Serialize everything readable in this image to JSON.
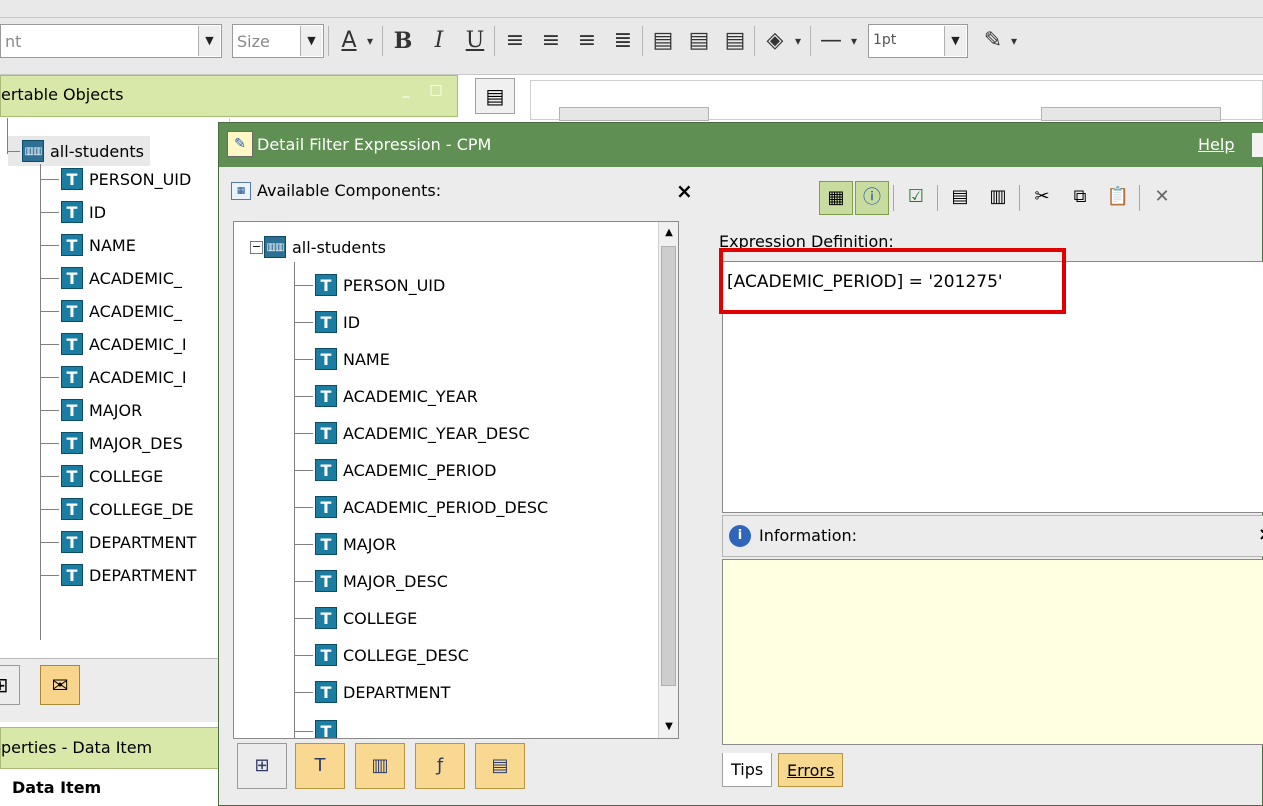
{
  "toolbar": {
    "font_value": "nt",
    "size_placeholder": "Size",
    "line_width": "1pt",
    "icons": {
      "font_color": "A",
      "bold": "B",
      "italic": "I",
      "underline": "U"
    }
  },
  "left_panel": {
    "title": "ertable Objects",
    "tree": {
      "root": "all-students",
      "items": [
        "PERSON_UID",
        "ID",
        "NAME",
        "ACADEMIC_",
        "ACADEMIC_",
        "ACADEMIC_I",
        "ACADEMIC_I",
        "MAJOR",
        "MAJOR_DES",
        "COLLEGE",
        "COLLEGE_DE",
        "DEPARTMENT",
        "DEPARTMENT"
      ]
    },
    "properties_title": "perties - Data Item",
    "data_item_label": "Data Item"
  },
  "dialog": {
    "title": "Detail Filter Expression - CPM",
    "help": "Help",
    "components_label": "Available Components:",
    "tree": {
      "root": "all-students",
      "items": [
        "PERSON_UID",
        "ID",
        "NAME",
        "ACADEMIC_YEAR",
        "ACADEMIC_YEAR_DESC",
        "ACADEMIC_PERIOD",
        "ACADEMIC_PERIOD_DESC",
        "MAJOR",
        "MAJOR_DESC",
        "COLLEGE",
        "COLLEGE_DESC",
        "DEPARTMENT"
      ]
    },
    "expression_label": "Expression Definition:",
    "expression": "[ACADEMIC_PERIOD] = '201275'",
    "information_label": "Information:",
    "tabs": {
      "tips": "Tips",
      "errors": "Errors"
    },
    "colors": {
      "title_bar": "#5f8f52",
      "highlight": "#e00000",
      "info_area": "#ffffe1"
    }
  }
}
